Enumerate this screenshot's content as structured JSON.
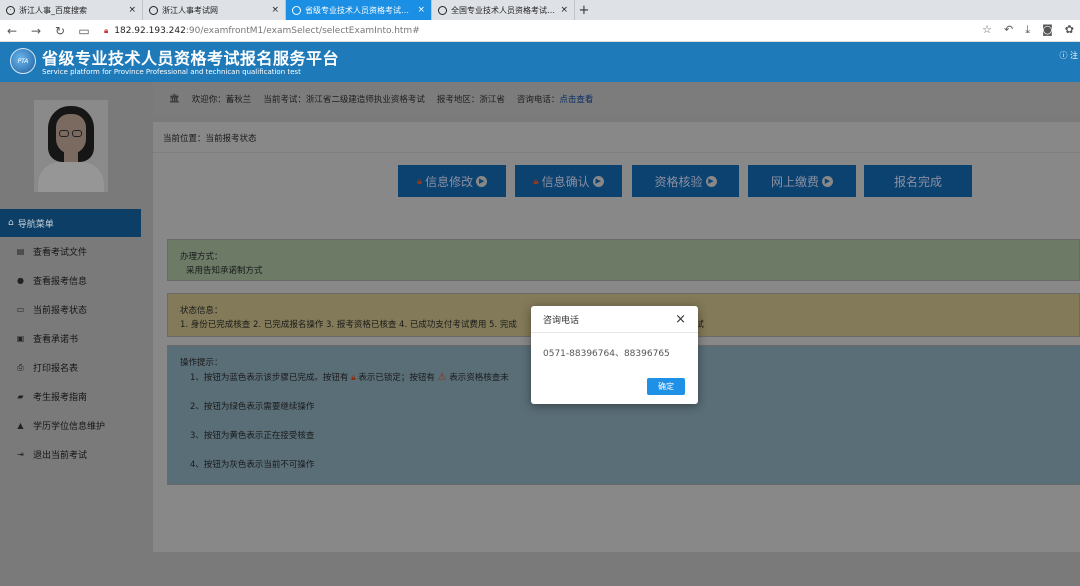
{
  "browser": {
    "tabs": [
      {
        "title": "浙江人事_百度搜索",
        "active": false
      },
      {
        "title": "浙江人事考试网",
        "active": false
      },
      {
        "title": "省级专业技术人员资格考试报名",
        "active": true
      },
      {
        "title": "全国专业技术人员资格考试服务",
        "active": false
      }
    ],
    "tab_close": "×",
    "new_tab": "+",
    "url_host": "182.92.193.242",
    "url_path": ":90/examfrontM1/examSelect/selectExamInto.htm#"
  },
  "header": {
    "title": "省级专业技术人员资格考试报名服务平台",
    "subtitle": "Service platform for Province Professional and technican qualification test",
    "logo_text": "PTA",
    "right_text": "注"
  },
  "sidebar": {
    "nav_title": "导航菜单",
    "items": [
      {
        "label": "查看考试文件",
        "icon": "document-icon"
      },
      {
        "label": "查看报考信息",
        "icon": "info-icon"
      },
      {
        "label": "当前报考状态",
        "icon": "monitor-icon"
      },
      {
        "label": "查看承诺书",
        "icon": "card-icon"
      },
      {
        "label": "打印报名表",
        "icon": "print-icon"
      },
      {
        "label": "考生报考指南",
        "icon": "book-icon"
      },
      {
        "label": "学历学位信息维护",
        "icon": "graduation-icon"
      },
      {
        "label": "退出当前考试",
        "icon": "logout-icon"
      }
    ]
  },
  "welcome": {
    "greeting": "欢迎你：蓄秋兰",
    "exam": "当前考试：浙江省二级建造师执业资格考试",
    "region": "报考地区：浙江省",
    "phone_label": "咨询电话：",
    "phone_link": "点击查看"
  },
  "breadcrumb": "当前位置：当前报考状态",
  "steps": [
    {
      "label": "信息修改",
      "locked": true,
      "arrow": true
    },
    {
      "label": "信息确认",
      "locked": true,
      "arrow": true
    },
    {
      "label": "资格核验",
      "locked": false,
      "arrow": true
    },
    {
      "label": "网上缴费",
      "locked": false,
      "arrow": true
    },
    {
      "label": "报名完成",
      "locked": false,
      "arrow": false
    }
  ],
  "method": {
    "title": "办理方式：",
    "text": "采用告知承诺制方式"
  },
  "status": {
    "title": "状态信息：",
    "text": "1. 身份已完成核查 2. 已完成报名操作 3. 报考资格已核查 4. 已成功支付考试费用 5. 完成",
    "tail": "考试"
  },
  "tips": {
    "title": "操作提示：",
    "line1_a": "1、按钮为蓝色表示该步骤已完成。按钮有",
    "line1_b": "表示已锁定；按钮有",
    "line1_c": "表示资格核查未",
    "line2": "2、按钮为绿色表示需要继续操作",
    "line3": "3、按钮为黄色表示正在接受核查",
    "line4": "4、按钮为灰色表示当前不可操作"
  },
  "modal": {
    "title": "咨询电话",
    "body": "0571-88396764、88396765",
    "ok": "确定",
    "close": "×"
  }
}
